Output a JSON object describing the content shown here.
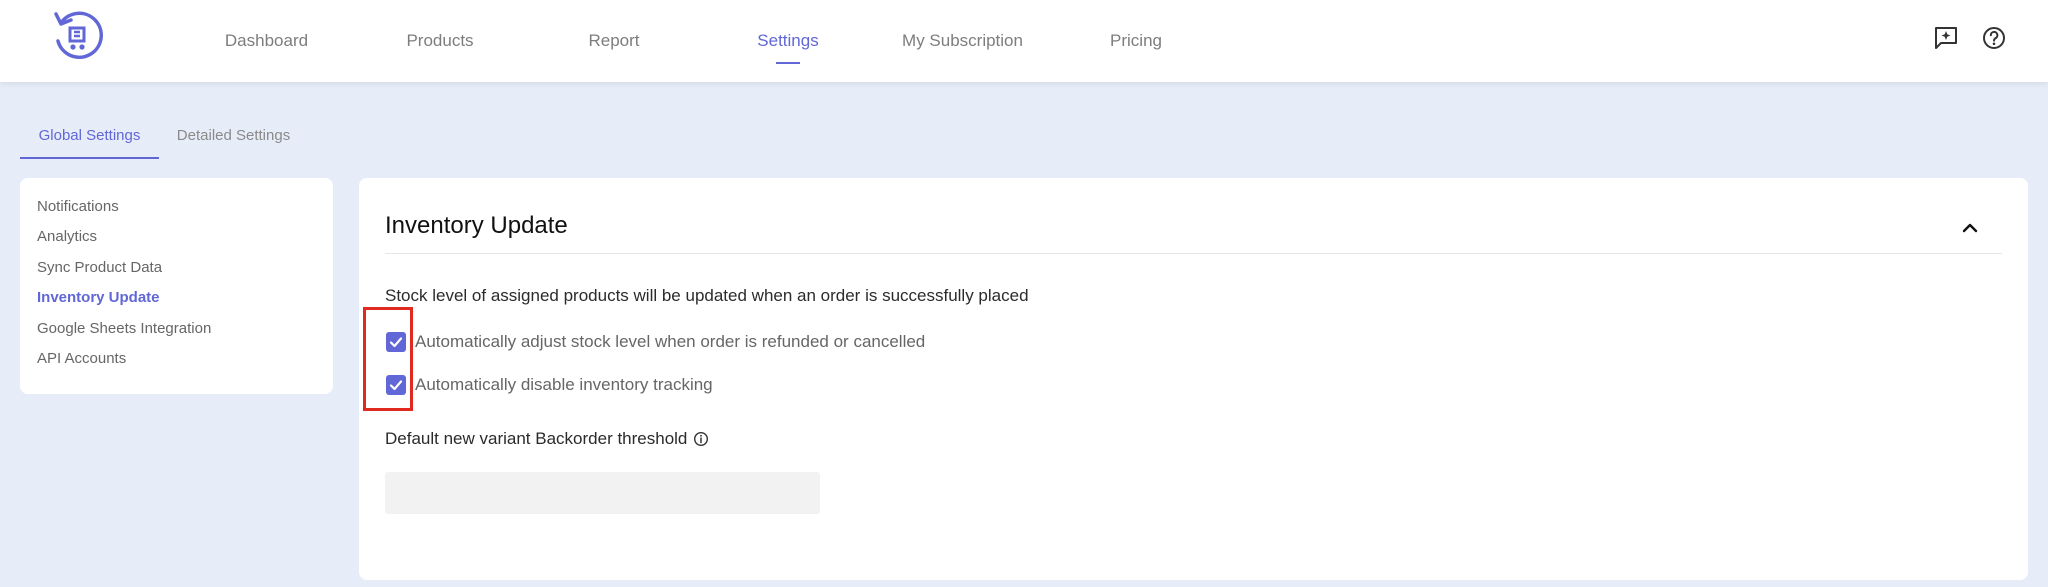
{
  "nav": {
    "items": [
      {
        "label": "Dashboard"
      },
      {
        "label": "Products"
      },
      {
        "label": "Report"
      },
      {
        "label": "Settings"
      },
      {
        "label": "My Subscription"
      },
      {
        "label": "Pricing"
      }
    ],
    "active": "Settings"
  },
  "top_icons": [
    "feedback-icon",
    "help-icon"
  ],
  "subtabs": {
    "items": [
      {
        "label": "Global Settings"
      },
      {
        "label": "Detailed Settings"
      }
    ],
    "active": "Global Settings"
  },
  "sidebar": {
    "items": [
      {
        "label": "Notifications"
      },
      {
        "label": "Analytics"
      },
      {
        "label": "Sync Product Data"
      },
      {
        "label": "Inventory Update"
      },
      {
        "label": "Google Sheets Integration"
      },
      {
        "label": "API Accounts"
      }
    ],
    "active": "Inventory Update"
  },
  "card": {
    "title": "Inventory Update",
    "description": "Stock level of assigned products will be updated when an order is successfully placed",
    "options": [
      {
        "label": "Automatically adjust stock level when order is refunded or cancelled",
        "checked": true
      },
      {
        "label": "Automatically disable inventory tracking",
        "checked": true
      }
    ],
    "threshold_label": "Default new variant Backorder threshold",
    "threshold_value": ""
  },
  "colors": {
    "accent": "#6167d6",
    "highlight": "#e02a20",
    "background": "#e7edf8"
  }
}
